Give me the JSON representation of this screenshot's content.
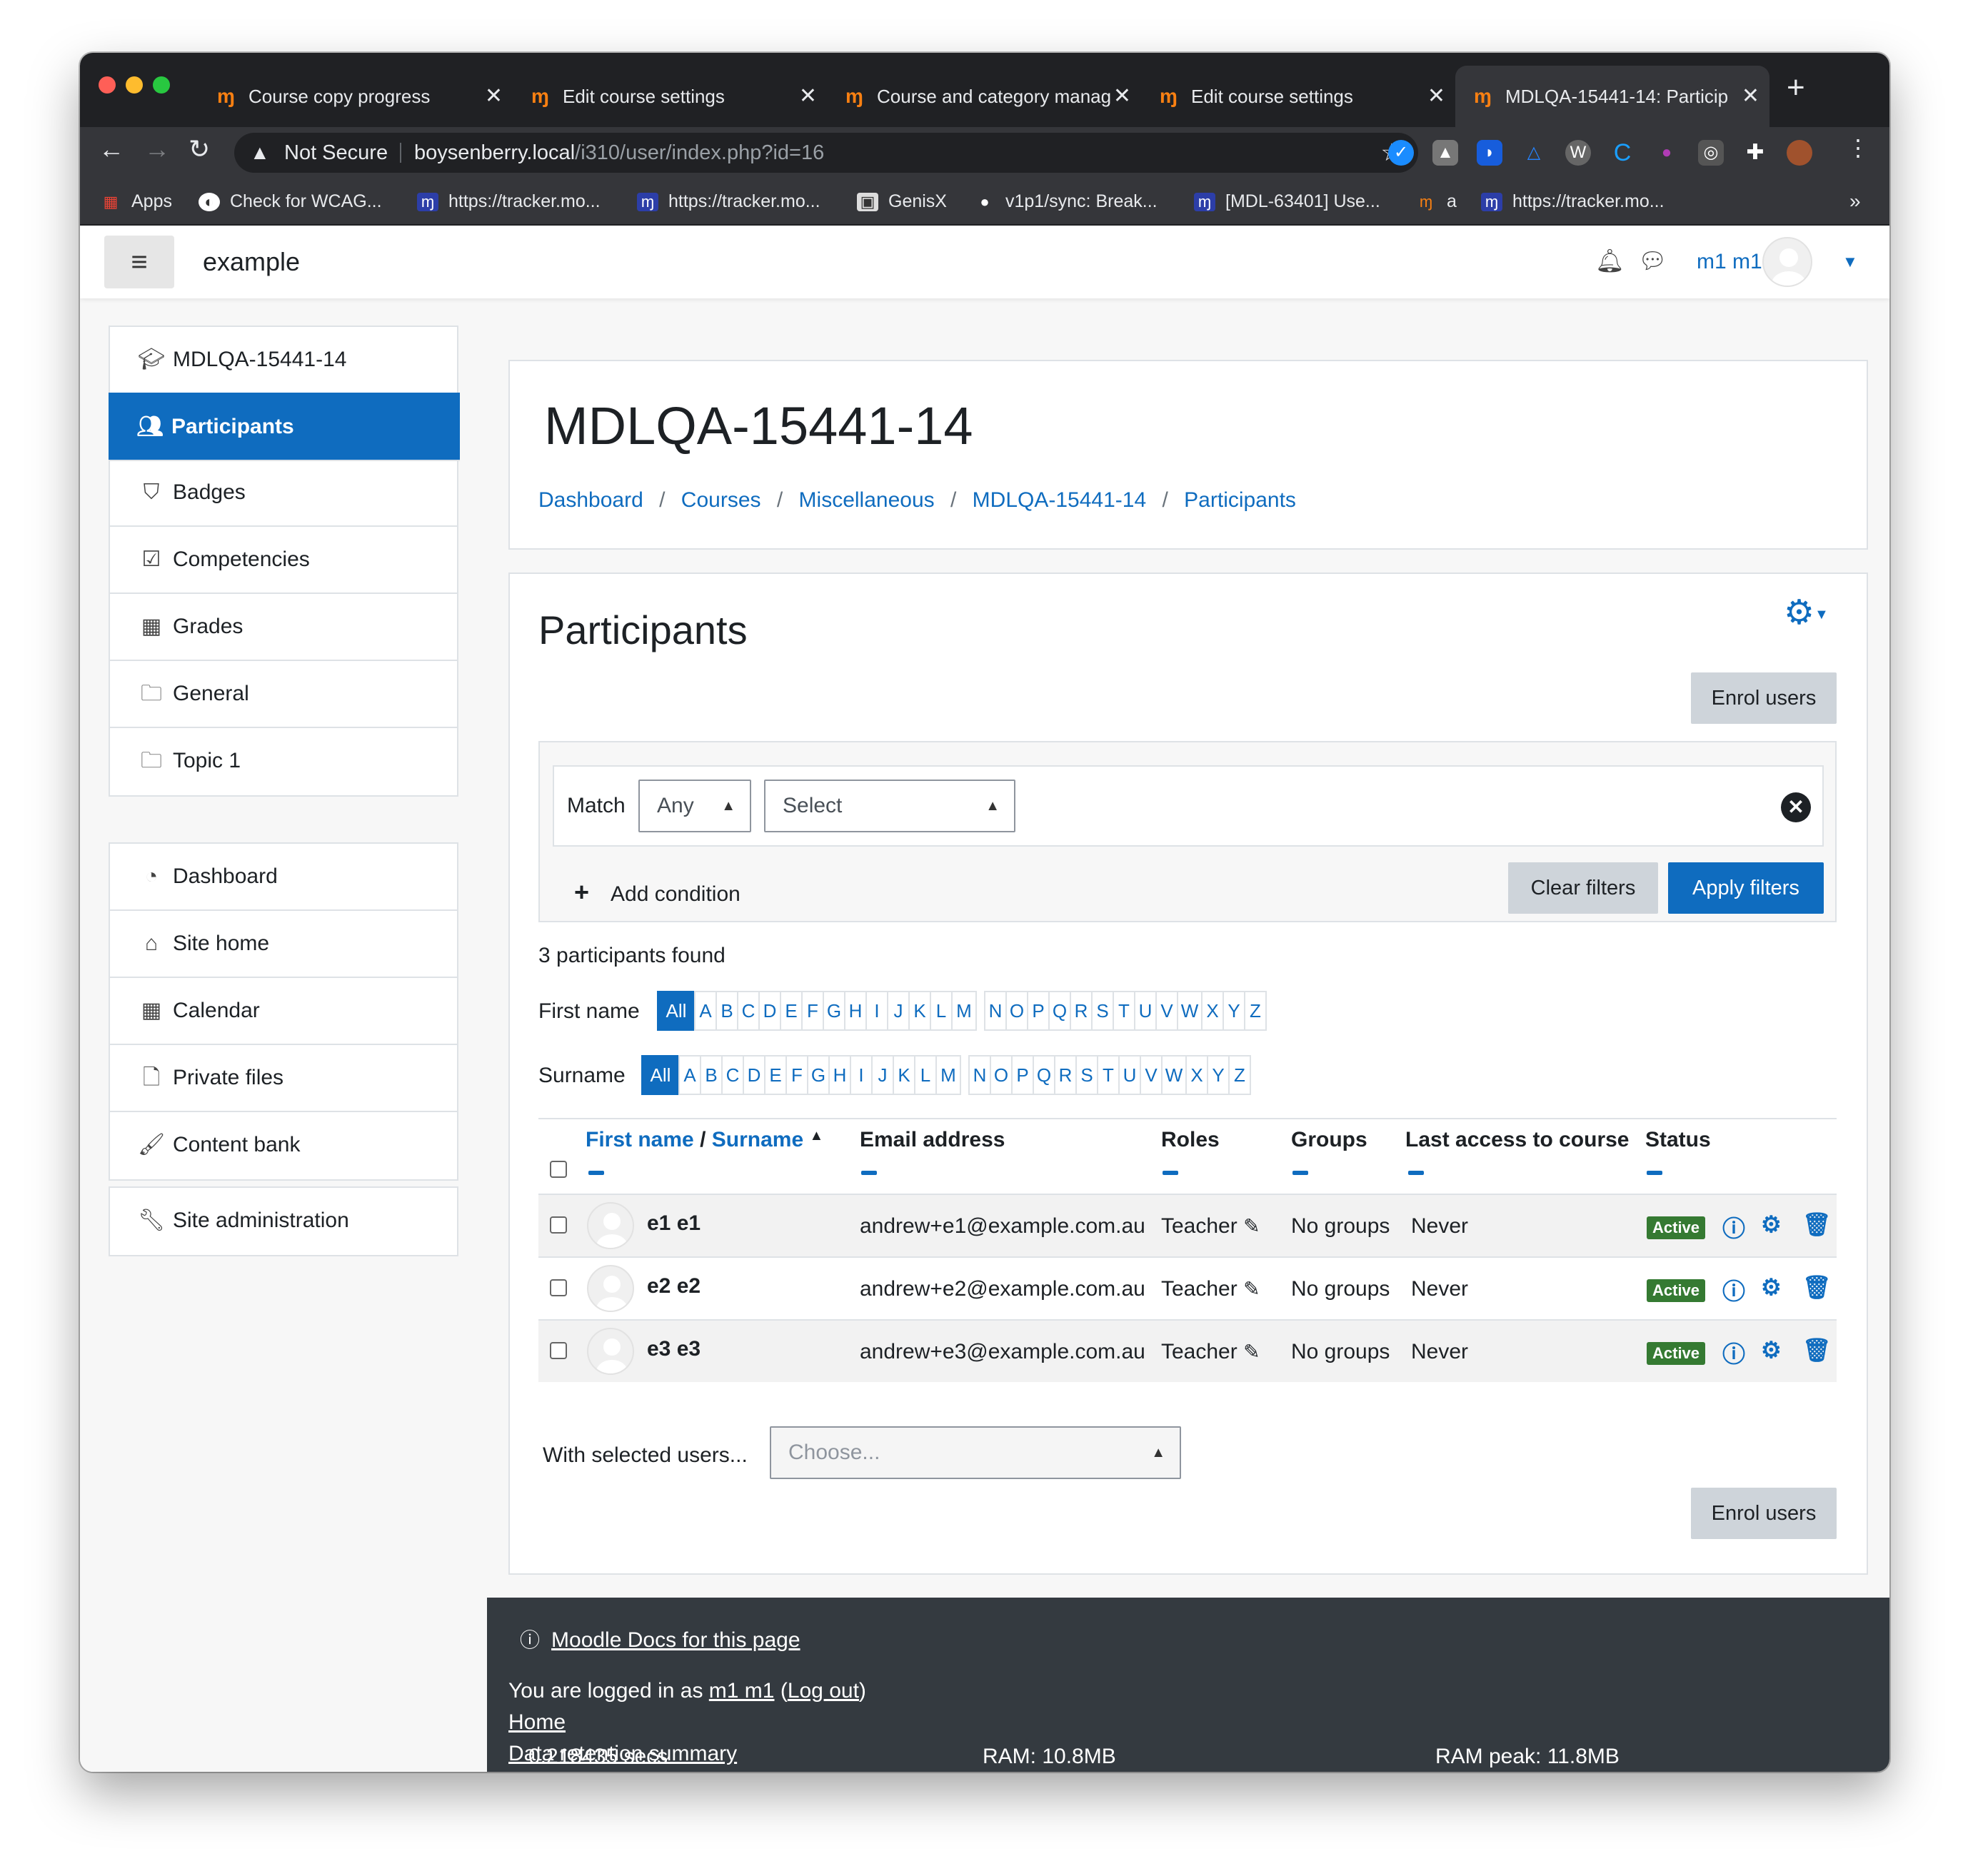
{
  "browser": {
    "tabs": [
      {
        "title": "Course copy progress",
        "close": "✕"
      },
      {
        "title": "Edit course settings",
        "close": "✕"
      },
      {
        "title": "Course and category manag",
        "close": "✕"
      },
      {
        "title": "Edit course settings",
        "close": "✕"
      },
      {
        "title": "MDLQA-15441-14: Particip",
        "close": "✕"
      }
    ],
    "new_tab": "+",
    "security": "Not Secure",
    "url_host": "boysenberry.local",
    "url_path": "/i310/user/index.php?id=16",
    "bookmarks": [
      "Apps",
      "Check for WCAG...",
      "https://tracker.mo...",
      "https://tracker.mo...",
      "GenisX",
      "v1p1/sync: Break...",
      "[MDL-63401] Use...",
      "a",
      "https://tracker.mo..."
    ],
    "bookmarks_more": "»"
  },
  "navbar": {
    "site_name": "example",
    "user_name": "m1 m1"
  },
  "sidebar": {
    "group1": [
      {
        "label": "MDLQA-15441-14",
        "icon": "graduation-cap-icon"
      },
      {
        "label": "Participants",
        "icon": "users-icon",
        "active": true
      },
      {
        "label": "Badges",
        "icon": "shield-icon"
      },
      {
        "label": "Competencies",
        "icon": "check-square-icon"
      },
      {
        "label": "Grades",
        "icon": "table-icon"
      },
      {
        "label": "General",
        "icon": "folder-icon"
      },
      {
        "label": "Topic 1",
        "icon": "folder-icon"
      }
    ],
    "group2": [
      {
        "label": "Dashboard",
        "icon": "dashboard-icon"
      },
      {
        "label": "Site home",
        "icon": "home-icon"
      },
      {
        "label": "Calendar",
        "icon": "calendar-icon"
      },
      {
        "label": "Private files",
        "icon": "file-icon"
      },
      {
        "label": "Content bank",
        "icon": "brush-icon"
      }
    ],
    "group3": [
      {
        "label": "Site administration",
        "icon": "wrench-icon"
      }
    ]
  },
  "header": {
    "title": "MDLQA-15441-14",
    "breadcrumb": [
      "Dashboard",
      "Courses",
      "Miscellaneous",
      "MDLQA-15441-14",
      "Participants"
    ],
    "separator": "/"
  },
  "participants": {
    "heading": "Participants",
    "enrol_label": "Enrol users",
    "filter": {
      "match_label": "Match",
      "match_value": "Any",
      "select_value": "Select",
      "add_condition": "Add condition",
      "clear": "Clear filters",
      "apply": "Apply filters"
    },
    "found": "3 participants found",
    "firstname_label": "First name",
    "surname_label": "Surname",
    "initials": [
      "All",
      "A",
      "B",
      "C",
      "D",
      "E",
      "F",
      "G",
      "H",
      "I",
      "J",
      "K",
      "L",
      "M",
      "N",
      "O",
      "P",
      "Q",
      "R",
      "S",
      "T",
      "U",
      "V",
      "W",
      "X",
      "Y",
      "Z"
    ],
    "columns": {
      "firstname": "First name",
      "slash": "/",
      "surname": "Surname",
      "email": "Email address",
      "roles": "Roles",
      "groups": "Groups",
      "lastaccess": "Last access to course",
      "status": "Status"
    },
    "rows": [
      {
        "name": "e1 e1",
        "email": "andrew+e1@example.com.au",
        "role": "Teacher",
        "groups": "No groups",
        "lastaccess": "Never",
        "status": "Active"
      },
      {
        "name": "e2 e2",
        "email": "andrew+e2@example.com.au",
        "role": "Teacher",
        "groups": "No groups",
        "lastaccess": "Never",
        "status": "Active"
      },
      {
        "name": "e3 e3",
        "email": "andrew+e3@example.com.au",
        "role": "Teacher",
        "groups": "No groups",
        "lastaccess": "Never",
        "status": "Active"
      }
    ],
    "with_selected_label": "With selected users...",
    "with_selected_placeholder": "Choose..."
  },
  "footer": {
    "docs_link": "Moodle Docs for this page",
    "logged_in_prefix": "You are logged in as",
    "logged_in_user": "m1 m1",
    "logout": "Log out",
    "home": "Home",
    "data_retention": "Data retention summary",
    "time": "0.218435 secs",
    "ram": "RAM: 10.8MB",
    "ram_peak": "RAM peak: 11.8MB"
  },
  "colors": {
    "brand": "#0f6cbf",
    "footer_bg": "#343a40",
    "active_badge": "#357a32"
  }
}
